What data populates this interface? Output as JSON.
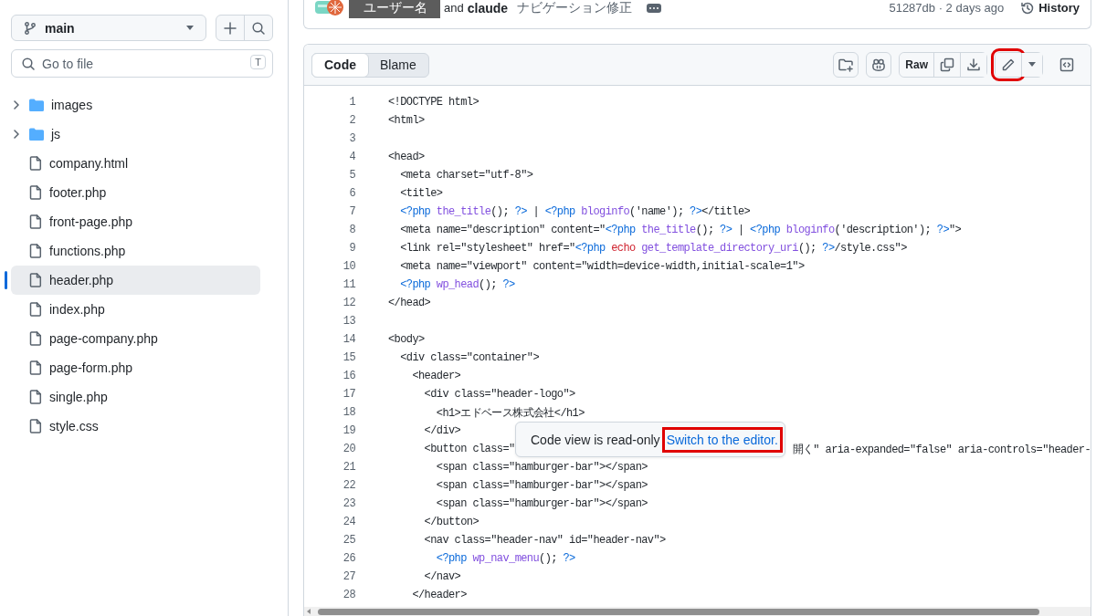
{
  "sidebar": {
    "branch": "main",
    "search": {
      "placeholder": "Go to file",
      "shortcut": "T"
    },
    "tree": [
      {
        "name": "images",
        "kind": "folder",
        "expanded": false,
        "selected": false
      },
      {
        "name": "js",
        "kind": "folder",
        "expanded": false,
        "selected": false
      },
      {
        "name": "company.html",
        "kind": "file",
        "selected": false
      },
      {
        "name": "footer.php",
        "kind": "file",
        "selected": false
      },
      {
        "name": "front-page.php",
        "kind": "file",
        "selected": false
      },
      {
        "name": "functions.php",
        "kind": "file",
        "selected": false
      },
      {
        "name": "header.php",
        "kind": "file",
        "selected": true
      },
      {
        "name": "index.php",
        "kind": "file",
        "selected": false
      },
      {
        "name": "page-company.php",
        "kind": "file",
        "selected": false
      },
      {
        "name": "page-form.php",
        "kind": "file",
        "selected": false
      },
      {
        "name": "single.php",
        "kind": "file",
        "selected": false
      },
      {
        "name": "style.css",
        "kind": "file",
        "selected": false
      }
    ]
  },
  "commit": {
    "author": "ユーザー名",
    "conjunction": "and",
    "coauthor": "claude",
    "message": "ナビゲーション修正",
    "hash_time": "51287db · 2 days ago",
    "history": "History"
  },
  "file_view": {
    "tabs": [
      {
        "label": "Code",
        "selected": true
      },
      {
        "label": "Blame",
        "selected": false
      }
    ],
    "raw": "Raw",
    "edit_highlighted": true,
    "lines": [
      {
        "number": "1",
        "tokens": [
          {
            "text": "<!DOCTYPE html>",
            "kind": "plain"
          }
        ]
      },
      {
        "number": "2",
        "tokens": [
          {
            "text": "<html>",
            "kind": "plain"
          }
        ]
      },
      {
        "number": "3"
      },
      {
        "number": "4",
        "tokens": [
          {
            "text": "<head>",
            "kind": "plain"
          }
        ]
      },
      {
        "number": "5",
        "tokens": [
          {
            "text": "  <meta charset=\"utf-8\">",
            "kind": "plain"
          }
        ]
      },
      {
        "number": "6",
        "tokens": [
          {
            "text": "  <title>",
            "kind": "plain"
          }
        ]
      },
      {
        "number": "7",
        "tokens": [
          {
            "text": "  <?php",
            "kind": "tag"
          },
          {
            "text": " the_title",
            "kind": "fn"
          },
          {
            "text": "(); ",
            "kind": "plain"
          },
          {
            "text": "?>",
            "kind": "tag"
          },
          {
            "text": " | ",
            "kind": "plain"
          },
          {
            "text": "<?php",
            "kind": "tag"
          },
          {
            "text": " bloginfo",
            "kind": "fn"
          },
          {
            "text": "('name'); ",
            "kind": "plain"
          },
          {
            "text": "?>",
            "kind": "tag"
          },
          {
            "text": "</title>",
            "kind": "plain"
          }
        ]
      },
      {
        "number": "8",
        "tokens": [
          {
            "text": "  <meta name=\"description\" content=\"",
            "kind": "plain"
          },
          {
            "text": "<?php",
            "kind": "tag"
          },
          {
            "text": " the_title",
            "kind": "fn"
          },
          {
            "text": "(); ",
            "kind": "plain"
          },
          {
            "text": "?>",
            "kind": "tag"
          },
          {
            "text": " | ",
            "kind": "plain"
          },
          {
            "text": "<?php",
            "kind": "tag"
          },
          {
            "text": " bloginfo",
            "kind": "fn"
          },
          {
            "text": "('description'); ",
            "kind": "plain"
          },
          {
            "text": "?>",
            "kind": "tag"
          },
          {
            "text": "\">",
            "kind": "plain"
          }
        ]
      },
      {
        "number": "9",
        "tokens": [
          {
            "text": "  <link rel=\"stylesheet\" href=\"",
            "kind": "plain"
          },
          {
            "text": "<?php",
            "kind": "tag"
          },
          {
            "text": " echo",
            "kind": "keyword"
          },
          {
            "text": " get_template_directory_uri",
            "kind": "fn"
          },
          {
            "text": "(); ",
            "kind": "plain"
          },
          {
            "text": "?>",
            "kind": "tag"
          },
          {
            "text": "/style.css\">",
            "kind": "plain"
          }
        ]
      },
      {
        "number": "10",
        "tokens": [
          {
            "text": "  <meta name=\"viewport\" content=\"width=device-width,initial-scale=1\">",
            "kind": "plain"
          }
        ]
      },
      {
        "number": "11",
        "tokens": [
          {
            "text": "  <?php",
            "kind": "tag"
          },
          {
            "text": " wp_head",
            "kind": "fn"
          },
          {
            "text": "(); ",
            "kind": "plain"
          },
          {
            "text": "?>",
            "kind": "tag"
          }
        ]
      },
      {
        "number": "12",
        "tokens": [
          {
            "text": "</head>",
            "kind": "plain"
          }
        ]
      },
      {
        "number": "13"
      },
      {
        "number": "14",
        "tokens": [
          {
            "text": "<body>",
            "kind": "plain"
          }
        ]
      },
      {
        "number": "15",
        "tokens": [
          {
            "text": "  <div class=\"container\">",
            "kind": "plain"
          }
        ]
      },
      {
        "number": "16",
        "tokens": [
          {
            "text": "    <header>",
            "kind": "plain"
          }
        ]
      },
      {
        "number": "17",
        "tokens": [
          {
            "text": "      <div class=\"header-logo\">",
            "kind": "plain"
          }
        ]
      },
      {
        "number": "18",
        "tokens": [
          {
            "text": "        <h1>エドベース株式会社</h1>",
            "kind": "plain"
          }
        ]
      },
      {
        "number": "19",
        "tokens": [
          {
            "text": "      </div>",
            "kind": "plain"
          }
        ]
      },
      {
        "number": "20",
        "tokens": [
          {
            "text": "      <button class=\"",
            "kind": "plain"
          },
          {
            "text": "開く\" aria-expanded=\"false\" aria-controls=\"header-",
            "kind": "plain",
            "after_tooltip": true
          }
        ]
      },
      {
        "number": "21",
        "tokens": [
          {
            "text": "        <span class=\"hamburger-bar\"></span>",
            "kind": "plain"
          }
        ]
      },
      {
        "number": "22",
        "tokens": [
          {
            "text": "        <span class=\"hamburger-bar\"></span>",
            "kind": "plain"
          }
        ]
      },
      {
        "number": "23",
        "tokens": [
          {
            "text": "        <span class=\"hamburger-bar\"></span>",
            "kind": "plain"
          }
        ]
      },
      {
        "number": "24",
        "tokens": [
          {
            "text": "      </button>",
            "kind": "plain"
          }
        ]
      },
      {
        "number": "25",
        "tokens": [
          {
            "text": "      <nav class=\"header-nav\" id=\"header-nav\">",
            "kind": "plain"
          }
        ]
      },
      {
        "number": "26",
        "tokens": [
          {
            "text": "        <?php",
            "kind": "tag"
          },
          {
            "text": " wp_nav_menu",
            "kind": "fn"
          },
          {
            "text": "(); ",
            "kind": "plain"
          },
          {
            "text": "?>",
            "kind": "tag"
          }
        ]
      },
      {
        "number": "27",
        "tokens": [
          {
            "text": "      </nav>",
            "kind": "plain"
          }
        ]
      },
      {
        "number": "28",
        "tokens": [
          {
            "text": "    </header>",
            "kind": "plain"
          }
        ]
      }
    ],
    "tooltip": {
      "text": "Code view is read-only",
      "link": "Switch to the editor.",
      "link_highlighted": true
    }
  }
}
